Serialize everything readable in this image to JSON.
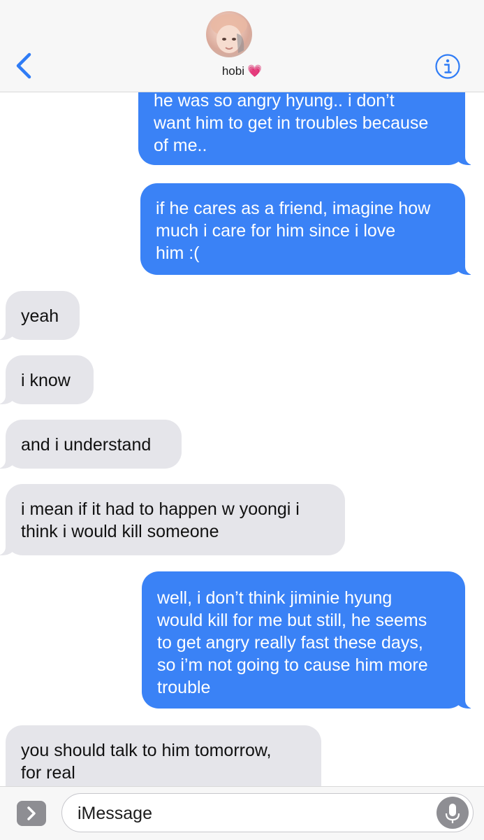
{
  "header": {
    "contact_name": "hobi",
    "heart_emoji": "💗",
    "back_icon": "chevron-left-icon",
    "info_icon": "info-icon",
    "accent_color": "#2f7cf6"
  },
  "messages": [
    {
      "direction": "sent",
      "text": "he was so angry hyung.. i don’t\nwant him to get in troubles because\nof me.."
    },
    {
      "direction": "sent",
      "text": "if he cares as a friend, imagine how\nmuch i care for him since i love\nhim :("
    },
    {
      "direction": "received",
      "text": "yeah"
    },
    {
      "direction": "received",
      "text": "i know"
    },
    {
      "direction": "received",
      "text": "and i understand"
    },
    {
      "direction": "received",
      "text": "i mean if it had to happen w yoongi i\nthink i would kill someone"
    },
    {
      "direction": "sent",
      "text": "well, i don’t think jiminie hyung\nwould kill for me but still, he seems\nto get angry really fast these days,\nso i’m not going to cause him more\ntrouble"
    },
    {
      "direction": "received",
      "text": "you should talk to him tomorrow,\nfor real"
    }
  ],
  "input": {
    "placeholder": "iMessage",
    "apps_icon": "chevron-right-icon",
    "mic_icon": "microphone-icon"
  },
  "colors": {
    "sent_bubble": "#3a82f6",
    "received_bubble": "#e5e5ea",
    "header_bg": "#f7f7f7"
  }
}
